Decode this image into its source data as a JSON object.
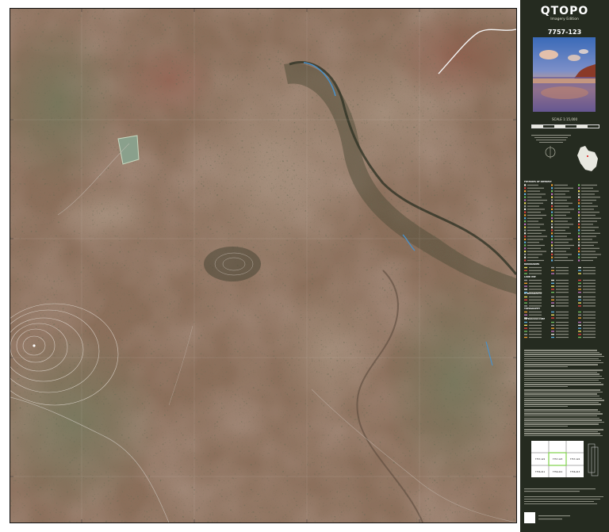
{
  "map": {
    "title": "QTOPO",
    "edition": "Imagery Edition",
    "sheet_number": "7757-123",
    "scale_label": "SCALE 1:15,000",
    "legend_headings": [
      "FEATURES OF INTEREST",
      "BOUNDARIES",
      "LAND USE",
      "HYDROGRAPHY",
      "TOPOGRAPHY",
      "INFRASTRUCTURE"
    ],
    "index_sheets": [
      "7757-122",
      "7757-123",
      "7757-124",
      "7756-411",
      "7756-412",
      "7756-413"
    ],
    "colors": {
      "panel": "#252b20",
      "road": "#f4f4f4",
      "water": "#4a90c8",
      "contour": "#d8d0c8",
      "index_highlight": "#7fd34a"
    }
  }
}
